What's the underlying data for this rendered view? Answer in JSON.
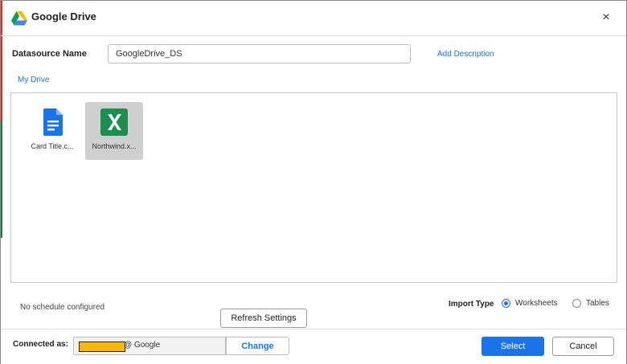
{
  "header": {
    "title": "Google Drive",
    "close_glyph": "×",
    "logo_icon": "google-drive-icon"
  },
  "datasource": {
    "label": "Datasource Name",
    "value": "GoogleDrive_DS",
    "add_description": "Add Description"
  },
  "breadcrumb": {
    "current": "My Drive"
  },
  "files": [
    {
      "name": "Card Title.c...",
      "icon": "google-docs-icon",
      "selected": false
    },
    {
      "name": "Northwind.x...",
      "icon": "excel-icon",
      "selected": true
    }
  ],
  "schedule": {
    "text": "No schedule configured"
  },
  "import_type": {
    "label": "Import Type",
    "options": [
      {
        "label": "Worksheets",
        "selected": true
      },
      {
        "label": "Tables",
        "selected": false
      }
    ]
  },
  "refresh_button": "Refresh Settings",
  "footer": {
    "connected_label": "Connected as:",
    "account_suffix": "@ Google",
    "change_label": "Change",
    "select_label": "Select",
    "cancel_label": "Cancel"
  },
  "colors": {
    "accent": "#1a73e8",
    "selection": "#cfcfcf",
    "redaction": "#f9b806"
  }
}
